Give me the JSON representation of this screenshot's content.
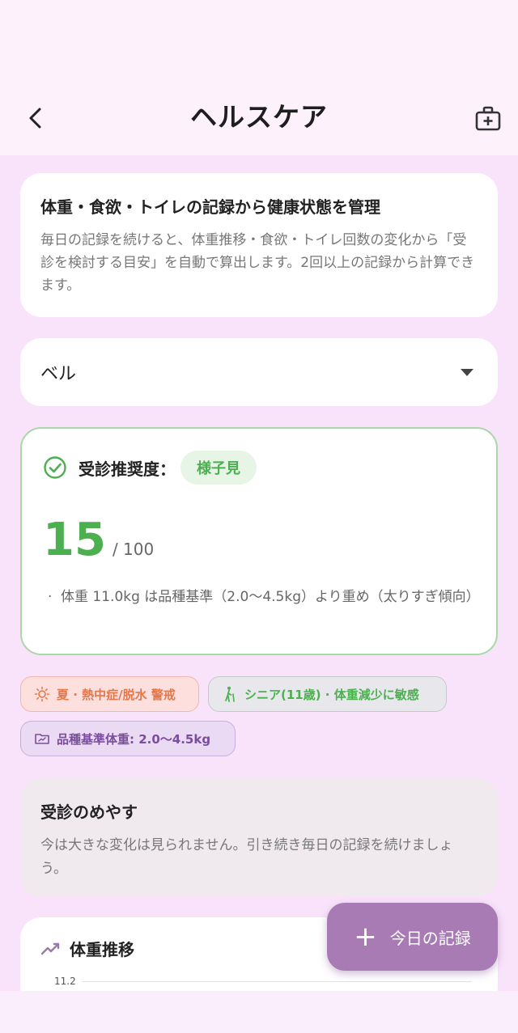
{
  "header": {
    "title": "ヘルスケア",
    "back_icon": "chevron-left-icon",
    "action_icon": "medical-kit-icon"
  },
  "intro": {
    "title": "体重・食欲・トイレの記録から健康状態を管理",
    "body": "毎日の記録を続けると、体重推移・食欲・トイレ回数の変化から「受診を検討する目安」を自動で算出します。2回以上の記録から計算できます。"
  },
  "pet_selector": {
    "selected": "ベル"
  },
  "recommendation": {
    "label": "受診推奨度：",
    "status": "様子見",
    "score": "15",
    "max": "/ 100",
    "reasons": [
      "体重 11.0kg は品種基準（2.0〜4.5kg）より重め（太りすぎ傾向）"
    ]
  },
  "chips": [
    {
      "label": "夏 · 熱中症/脱水 警戒",
      "icon": "sun-icon"
    },
    {
      "label": "シニア(11歳) · 体重減少に敏感",
      "icon": "elderly-walker-icon"
    },
    {
      "label": "品種基準体重: 2.0〜4.5kg",
      "icon": "folder-chart-icon"
    }
  ],
  "guide": {
    "title": "受診のめやす",
    "body": "今は大きな変化は見られません。引き続き毎日の記録を続けましょう。"
  },
  "weight_trend": {
    "title": "体重推移",
    "y_tick_top": "11.2"
  },
  "fab": {
    "label": "今日の記録"
  },
  "colors": {
    "accent_purple": "#a87bb5",
    "status_green": "#4caf50",
    "background": "#f9e3fb"
  }
}
